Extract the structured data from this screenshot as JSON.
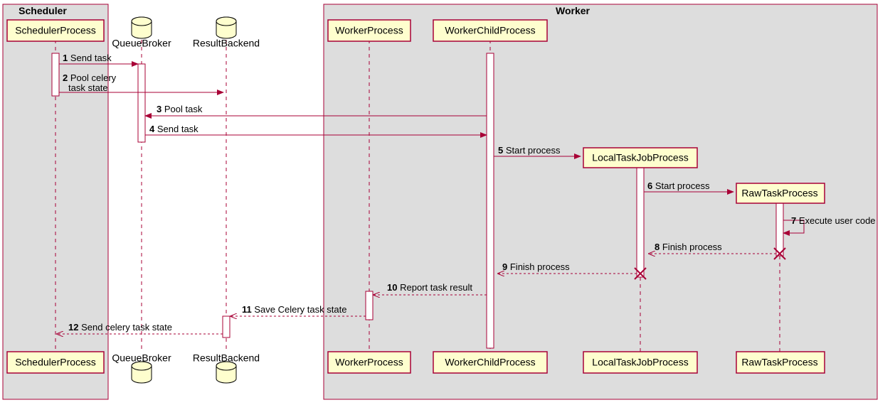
{
  "groups": {
    "scheduler": "Scheduler",
    "worker": "Worker"
  },
  "participants": {
    "scheduler_process": "SchedulerProcess",
    "queue_broker": "QueueBroker",
    "result_backend": "ResultBackend",
    "worker_process": "WorkerProcess",
    "worker_child_process": "WorkerChildProcess",
    "local_task_job_process": "LocalTaskJobProcess",
    "raw_task_process": "RawTaskProcess"
  },
  "messages": {
    "m1": {
      "n": "1",
      "t": "Send task"
    },
    "m2": {
      "n": "2",
      "t1": "Pool celery",
      "t2": "task state"
    },
    "m3": {
      "n": "3",
      "t": "Pool task"
    },
    "m4": {
      "n": "4",
      "t": "Send task"
    },
    "m5": {
      "n": "5",
      "t": "Start process"
    },
    "m6": {
      "n": "6",
      "t": "Start process"
    },
    "m7": {
      "n": "7",
      "t": "Execute user code"
    },
    "m8": {
      "n": "8",
      "t": "Finish process"
    },
    "m9": {
      "n": "9",
      "t": "Finish process"
    },
    "m10": {
      "n": "10",
      "t": "Report task result"
    },
    "m11": {
      "n": "11",
      "t": "Save Celery task state"
    },
    "m12": {
      "n": "12",
      "t": "Send celery task state"
    }
  }
}
